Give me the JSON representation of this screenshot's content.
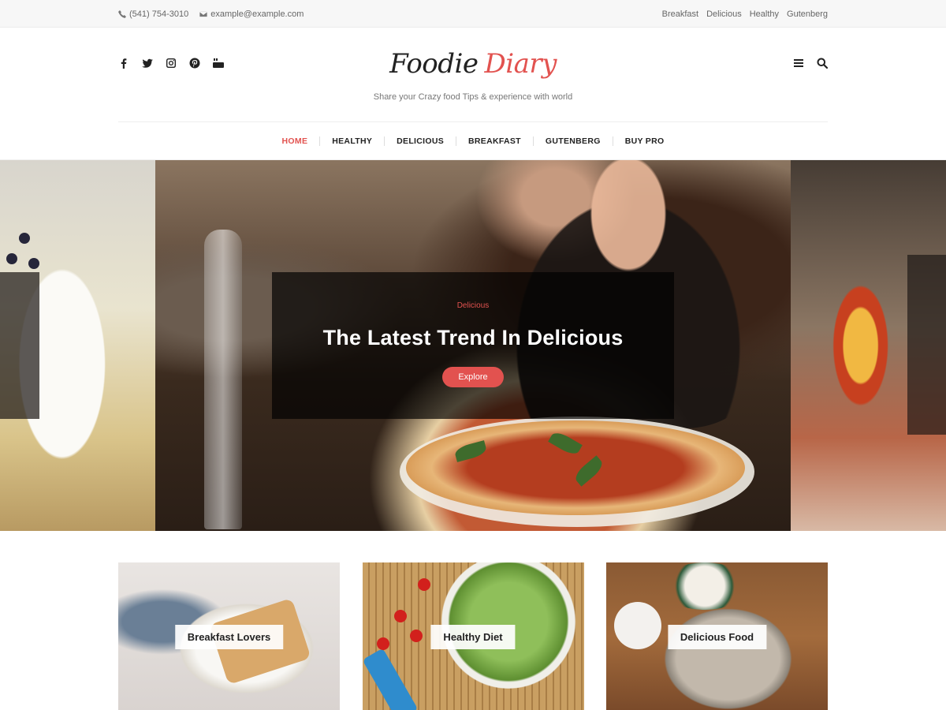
{
  "topbar": {
    "phone": "(541) 754-3010",
    "email": "example@example.com",
    "links": [
      "Breakfast",
      "Delicious",
      "Healthy",
      "Gutenberg"
    ]
  },
  "header": {
    "logo_word1": "Foodie",
    "logo_word2": "Diary",
    "tagline": "Share your Crazy food Tips & experience with world",
    "social_icons": [
      "facebook-icon",
      "twitter-icon",
      "instagram-icon",
      "pinterest-icon",
      "youtube-icon"
    ],
    "tool_icons": [
      "menu-icon",
      "search-icon"
    ]
  },
  "nav": {
    "items": [
      "HOME",
      "HEALTHY",
      "DELICIOUS",
      "BREAKFAST",
      "GUTENBERG",
      "BUY PRO"
    ],
    "active_index": 0
  },
  "hero": {
    "category": "Delicious",
    "title": "The Latest Trend In Delicious",
    "button": "Explore"
  },
  "cards": [
    {
      "label": "Breakfast Lovers"
    },
    {
      "label": "Healthy Diet"
    },
    {
      "label": "Delicious Food"
    }
  ],
  "colors": {
    "accent": "#e2524f",
    "text": "#222222",
    "topbar_bg": "#f7f7f7"
  }
}
